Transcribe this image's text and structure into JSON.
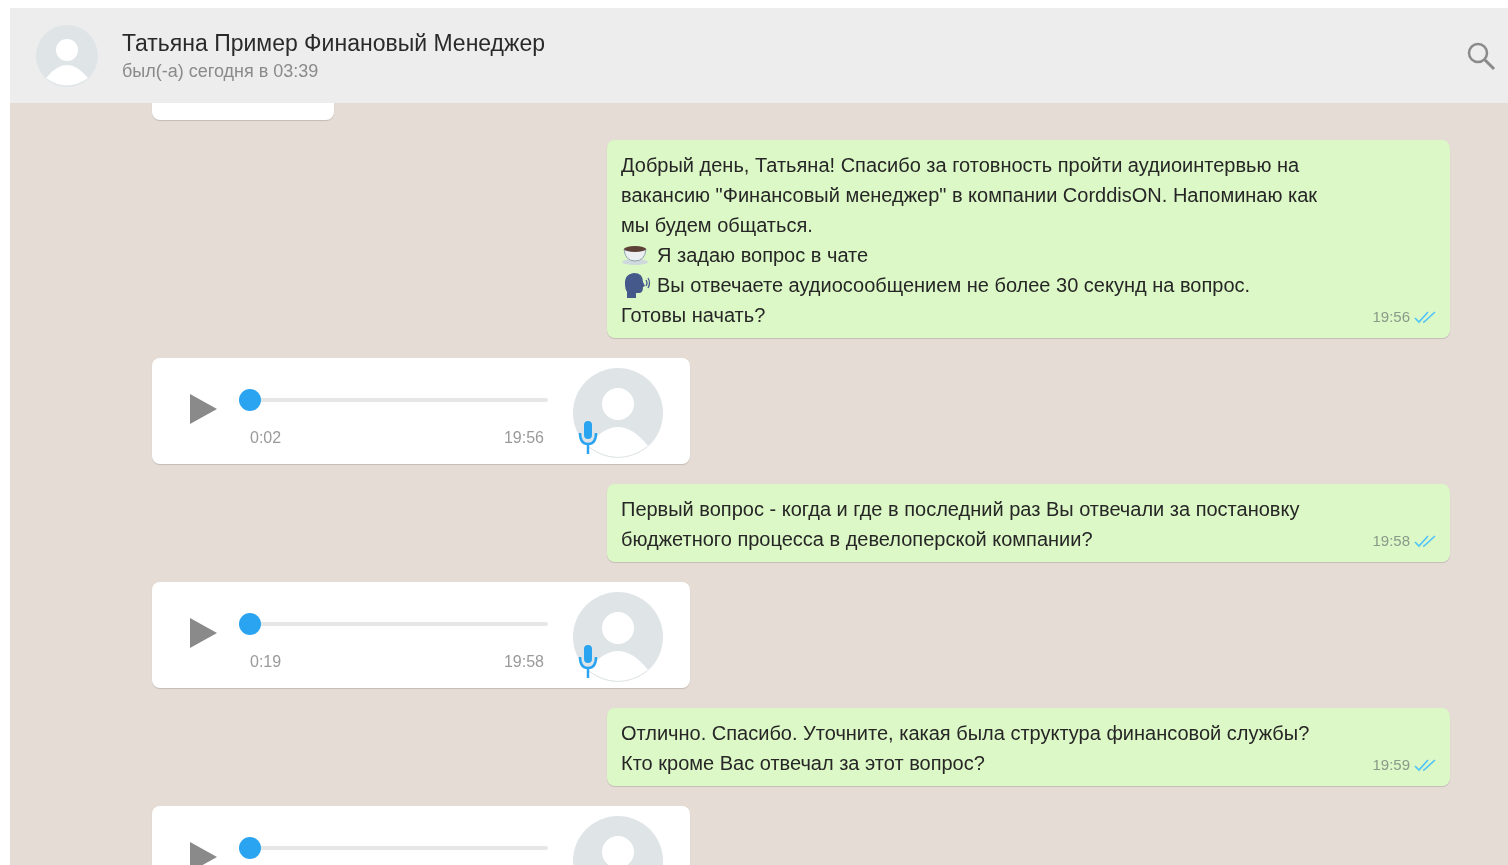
{
  "header": {
    "name": "Татьяна Пример Финановый Менеджер",
    "status": "был(-а) сегодня в 03:39"
  },
  "messages": [
    {
      "kind": "cut"
    },
    {
      "kind": "text",
      "time": "19:56",
      "read": true,
      "lines": [
        {
          "kind": "plain",
          "text": "Добрый день, Татьяна! Спасибо за готовность пройти аудиоинтервью на вакансию \"Финансовый менеджер\" в компании CorddisON. Напоминаю как мы будем общаться."
        },
        {
          "kind": "cup",
          "text": "Я задаю вопрос в чате"
        },
        {
          "kind": "speaker",
          "text": "Вы отвечаете аудиосообщением не более 30 секунд на вопрос."
        },
        {
          "kind": "plain",
          "text": "Готовы начать?"
        }
      ]
    },
    {
      "kind": "voice",
      "duration": "0:02",
      "time": "19:56",
      "level": 0
    },
    {
      "kind": "text",
      "time": "19:58",
      "read": true,
      "lines": [
        {
          "kind": "plain",
          "text": "Первый вопрос - когда и где в последний раз Вы отвечали за постановку бюджетного процесса в девелоперской компании?"
        }
      ]
    },
    {
      "kind": "voice",
      "duration": "0:19",
      "time": "19:58",
      "level": 0
    },
    {
      "kind": "text",
      "time": "19:59",
      "read": true,
      "lines": [
        {
          "kind": "plain",
          "text": "Отлично. Спасибо. Уточните, какая была структура финансовой службы? Кто кроме Вас отвечал за этот вопрос?"
        }
      ]
    },
    {
      "kind": "voice",
      "level": 0
    }
  ]
}
